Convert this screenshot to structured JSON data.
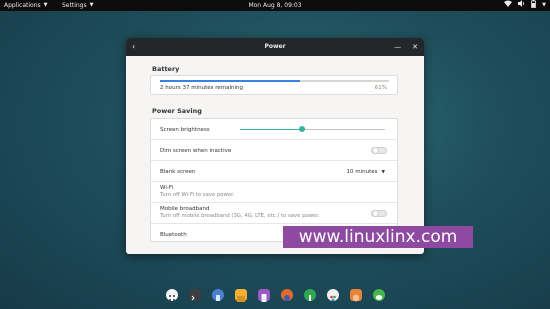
{
  "topbar": {
    "applications_label": "Applications",
    "settings_label": "Settings",
    "clock": "Mon Aug  8, 09:03"
  },
  "dialog": {
    "title": "Power",
    "battery": {
      "section_title": "Battery",
      "remaining": "2 hours 37 minutes remaining",
      "percent_label": "61%",
      "level": 0.61
    },
    "power_saving": {
      "section_title": "Power Saving",
      "screen_brightness_label": "Screen brightness",
      "brightness_level": 0.43,
      "dim_screen_label": "Dim screen when inactive",
      "blank_screen_label": "Blank screen",
      "blank_screen_value": "10 minutes",
      "wifi_label": "Wi-Fi",
      "wifi_desc": "Turn off Wi-Fi to save power.",
      "mobile_label": "Mobile broadband",
      "mobile_desc": "Turn off mobile broadband (3G, 4G, LTE, etc.) to save power.",
      "bluetooth_label": "Bluetooth"
    }
  },
  "watermark": "www.linuxlinx.com",
  "colors": {
    "accent": "#3584e4",
    "slider": "#3bb3a3",
    "watermark_bg": "#8e49a0"
  },
  "dock_apps": [
    "app-grid-icon",
    "terminal-icon",
    "network-icon",
    "files-icon",
    "texteditor-icon",
    "firefox-icon",
    "vpn-icon",
    "palette-icon",
    "package-icon",
    "chat-icon"
  ]
}
